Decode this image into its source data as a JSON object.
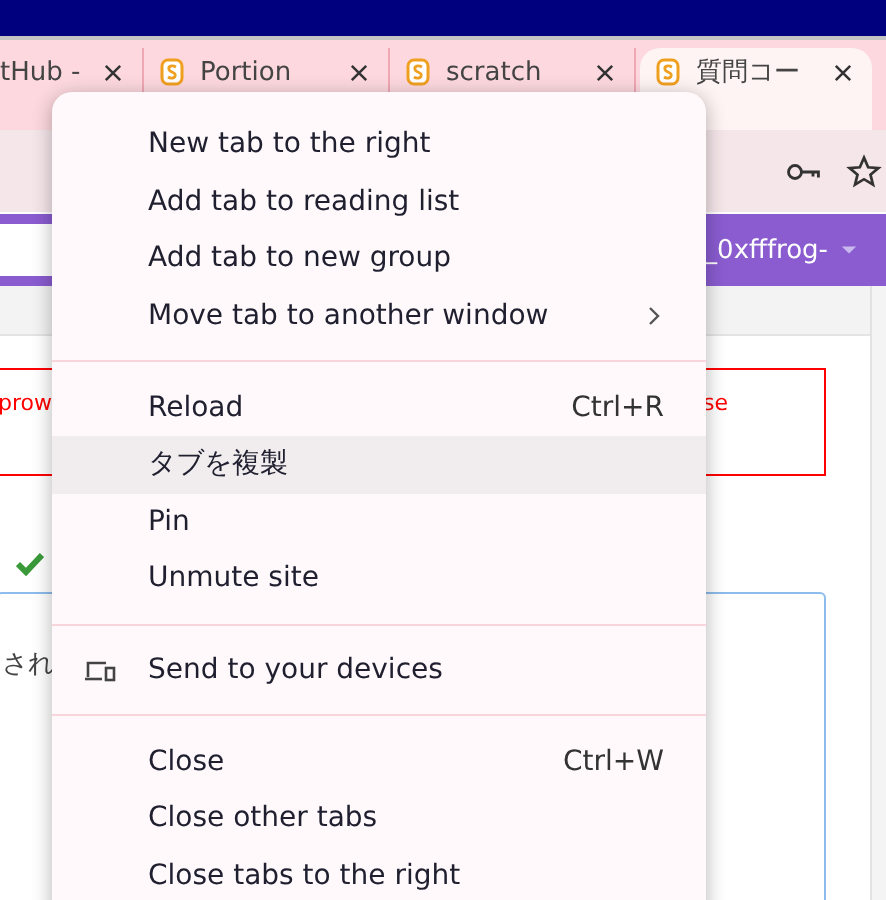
{
  "tabs": [
    {
      "title": "tHub -",
      "selected": false,
      "favicon": false
    },
    {
      "title": "Portion",
      "selected": false,
      "favicon": true
    },
    {
      "title": "scratch",
      "selected": false,
      "favicon": true
    },
    {
      "title": "質問コー",
      "selected": true,
      "favicon": true
    }
  ],
  "site_header": {
    "user": "_0xfffrog-"
  },
  "alert": {
    "text_left": "prow",
    "text_right": "se"
  },
  "answer_box": {
    "text": "され"
  },
  "context_menu": {
    "sections": [
      [
        {
          "label": "New tab to the right",
          "kind": "plain",
          "highlighted": false
        },
        {
          "label": "Add tab to reading list",
          "kind": "plain",
          "highlighted": false
        },
        {
          "label": "Add tab to new group",
          "kind": "plain",
          "highlighted": false
        },
        {
          "label": "Move tab to another window",
          "kind": "submenu",
          "highlighted": false
        }
      ],
      [
        {
          "label": "Reload",
          "kind": "plain",
          "shortcut": "Ctrl+R",
          "highlighted": false
        },
        {
          "label": "タブを複製",
          "kind": "plain",
          "highlighted": true
        },
        {
          "label": "Pin",
          "kind": "plain",
          "highlighted": false
        },
        {
          "label": "Unmute site",
          "kind": "plain",
          "highlighted": false
        }
      ],
      [
        {
          "label": "Send to your devices",
          "kind": "devices",
          "highlighted": false
        }
      ],
      [
        {
          "label": "Close",
          "kind": "plain",
          "shortcut": "Ctrl+W",
          "highlighted": false
        },
        {
          "label": "Close other tabs",
          "kind": "plain",
          "highlighted": false
        },
        {
          "label": "Close tabs to the right",
          "kind": "plain",
          "highlighted": false
        }
      ]
    ]
  }
}
